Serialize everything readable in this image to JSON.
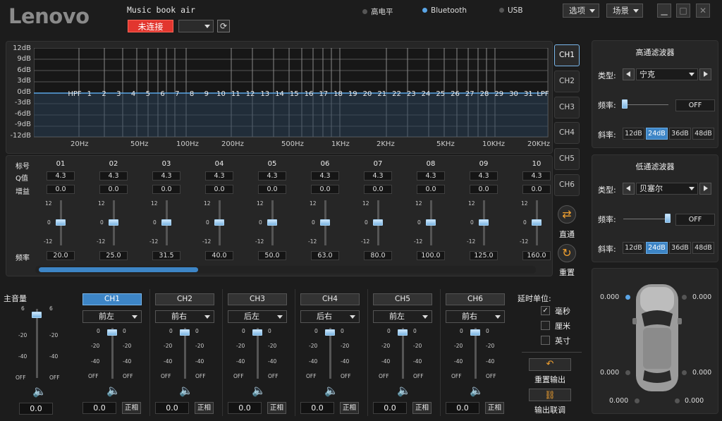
{
  "app": {
    "logo": "Lenovo",
    "device_name": "Music book air",
    "connect_status": "未连接",
    "refresh_icon": "refresh-icon"
  },
  "sources": [
    {
      "label": "高电平",
      "active": false
    },
    {
      "label": "Bluetooth",
      "active": true
    },
    {
      "label": "USB",
      "active": false
    }
  ],
  "menus": {
    "options": "选项",
    "scene": "场景"
  },
  "graph": {
    "y_ticks": [
      "12dB",
      "9dB",
      "6dB",
      "3dB",
      "0dB",
      "-3dB",
      "-6dB",
      "-9dB",
      "-12dB"
    ],
    "x_ticks": [
      "20Hz",
      "50Hz",
      "100Hz",
      "200Hz",
      "500Hz",
      "1KHz",
      "2KHz",
      "5KHz",
      "10KHz",
      "20KHz"
    ],
    "band_markers": [
      "HPF",
      "1",
      "2",
      "3",
      "4",
      "5",
      "6",
      "7",
      "8",
      "9",
      "10",
      "11",
      "12",
      "13",
      "14",
      "15",
      "16",
      "17",
      "18",
      "19",
      "20",
      "21",
      "22",
      "23",
      "24",
      "25",
      "26",
      "27",
      "28",
      "29",
      "30",
      "31",
      "LPF"
    ]
  },
  "channels_side": [
    "CH1",
    "CH2",
    "CH3",
    "CH4",
    "CH5",
    "CH6"
  ],
  "side_actions": {
    "bypass": "直通",
    "reset": "重置"
  },
  "eq": {
    "row_labels": {
      "label": "标号",
      "q": "Q值",
      "gain": "增益",
      "freq": "频率"
    },
    "slider_ticks": {
      "top": "12",
      "mid": "0",
      "bottom": "-12"
    },
    "bands": [
      {
        "id": "01",
        "q": "4.3",
        "gain": "0.0",
        "freq": "20.0",
        "level": 0
      },
      {
        "id": "02",
        "q": "4.3",
        "gain": "0.0",
        "freq": "25.0",
        "level": 0
      },
      {
        "id": "03",
        "q": "4.3",
        "gain": "0.0",
        "freq": "31.5",
        "level": 0
      },
      {
        "id": "04",
        "q": "4.3",
        "gain": "0.0",
        "freq": "40.0",
        "level": 0
      },
      {
        "id": "05",
        "q": "4.3",
        "gain": "0.0",
        "freq": "50.0",
        "level": 0
      },
      {
        "id": "06",
        "q": "4.3",
        "gain": "0.0",
        "freq": "63.0",
        "level": 0
      },
      {
        "id": "07",
        "q": "4.3",
        "gain": "0.0",
        "freq": "80.0",
        "level": 0
      },
      {
        "id": "08",
        "q": "4.3",
        "gain": "0.0",
        "freq": "100.0",
        "level": 0
      },
      {
        "id": "09",
        "q": "4.3",
        "gain": "0.0",
        "freq": "125.0",
        "level": 0
      },
      {
        "id": "10",
        "q": "4.3",
        "gain": "0.0",
        "freq": "160.0",
        "level": 0
      }
    ]
  },
  "hpf": {
    "title": "高通滤波器",
    "type_label": "类型:",
    "type_value": "宁克",
    "freq_label": "频率:",
    "freq_value": "OFF",
    "slope_label": "斜率:",
    "slopes": [
      "12dB",
      "24dB",
      "36dB",
      "48dB"
    ],
    "active_slope": "24dB"
  },
  "lpf": {
    "title": "低通滤波器",
    "type_label": "类型:",
    "type_value": "贝塞尔",
    "freq_label": "频率:",
    "freq_value": "OFF",
    "slope_label": "斜率:",
    "slopes": [
      "12dB",
      "24dB",
      "36dB",
      "48dB"
    ],
    "active_slope": "24dB"
  },
  "master": {
    "label": "主音量",
    "ticks": [
      "6",
      "-20",
      "-40",
      "OFF"
    ],
    "value": "0.0"
  },
  "out_channels": [
    {
      "name": "CH1",
      "position": "前左",
      "value": "0.0",
      "phase": "正相",
      "active": true
    },
    {
      "name": "CH2",
      "position": "前右",
      "value": "0.0",
      "phase": "正相",
      "active": false
    },
    {
      "name": "CH3",
      "position": "后左",
      "value": "0.0",
      "phase": "正相",
      "active": false
    },
    {
      "name": "CH4",
      "position": "后右",
      "value": "0.0",
      "phase": "正相",
      "active": false
    },
    {
      "name": "CH5",
      "position": "前左",
      "value": "0.0",
      "phase": "正相",
      "active": false
    },
    {
      "name": "CH6",
      "position": "前右",
      "value": "0.0",
      "phase": "正相",
      "active": false
    }
  ],
  "out_ticks": [
    "0",
    "-20",
    "-40",
    "OFF"
  ],
  "delay": {
    "label": "延时单位:",
    "units": [
      {
        "label": "毫秒",
        "checked": true
      },
      {
        "label": "厘米",
        "checked": false
      },
      {
        "label": "英寸",
        "checked": false
      }
    ]
  },
  "output_actions": {
    "reset": "重置输出",
    "link": "输出联调"
  },
  "speaker_delays": {
    "fl": "0.000",
    "fr": "0.000",
    "ml": "0.000",
    "mr": "0.000",
    "rl": "0.000",
    "rr": "0.000"
  }
}
